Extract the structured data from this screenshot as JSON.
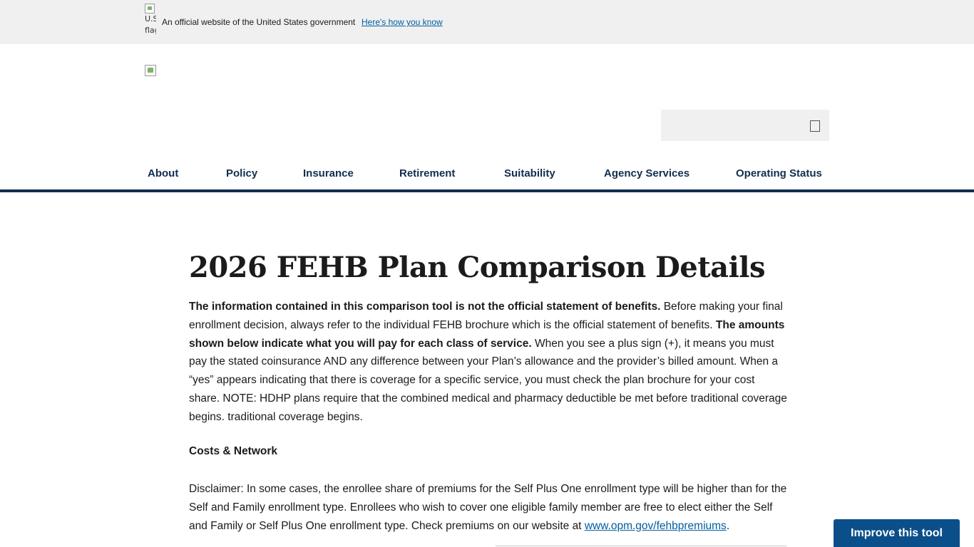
{
  "gov_banner": {
    "flag_alt": "U.S. flag",
    "text": "An official website of the United States government",
    "link": "Here's how you know"
  },
  "search": {
    "placeholder": ""
  },
  "nav": {
    "items": [
      {
        "label": "About"
      },
      {
        "label": "Policy"
      },
      {
        "label": "Insurance"
      },
      {
        "label": "Retirement"
      },
      {
        "label": "Suitability"
      },
      {
        "label": "Agency Services"
      },
      {
        "label": "Operating Status"
      }
    ]
  },
  "main": {
    "title": "2026 FEHB Plan Comparison Details",
    "intro": {
      "bold1": "The information contained in this comparison tool is not the official statement of benefits.",
      "text1": " Before making your final enrollment decision, always refer to the individual FEHB brochure which is the official statement of benefits. ",
      "bold2": "The amounts shown below indicate what you will pay for each class of service.",
      "text2": " When you see a plus sign (+), it means you must pay the stated coinsurance AND any difference between your Plan’s allowance and the provider’s billed amount. When a “yes” appears indicating that there is coverage for a specific service, you must check the plan brochure for your cost share. NOTE: HDHP plans require that the combined medical and pharmacy deductible be met before traditional coverage begins. traditional coverage begins."
    },
    "section_heading": "Costs & Network",
    "disclaimer": {
      "text": "Disclaimer: In some cases, the enrollee share of premiums for the Self Plus One enrollment type will be higher than for the Self and Family enrollment type. Enrollees who wish to cover one eligible family member are free to elect either the Self and Family or Self Plus One enrollment type. Check premiums on our website at ",
      "link": "www.opm.gov/fehbpremiums",
      "end": "."
    }
  },
  "feedback": {
    "button_label": "Improve this tool"
  },
  "colors": {
    "nav_text": "#112e51",
    "nav_rule": "#112e51",
    "link": "#005ea2",
    "feedback_bg": "#0b4f8a",
    "banner_bg": "#f0f0f0"
  }
}
